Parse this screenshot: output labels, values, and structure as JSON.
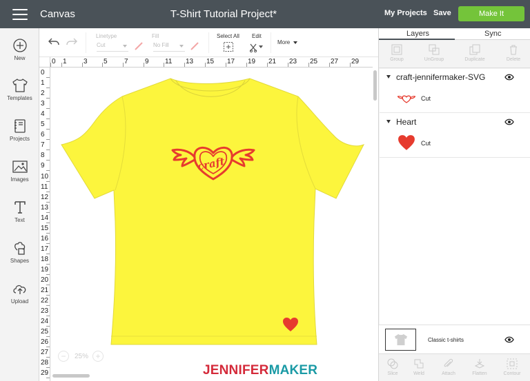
{
  "header": {
    "app_title": "Canvas",
    "project_title": "T-Shirt Tutorial Project*",
    "my_projects": "My Projects",
    "save": "Save",
    "make_it": "Make It"
  },
  "sidebar": {
    "items": [
      {
        "label": "New",
        "icon": "plus-circle-icon"
      },
      {
        "label": "Templates",
        "icon": "shirt-icon"
      },
      {
        "label": "Projects",
        "icon": "notebook-icon"
      },
      {
        "label": "Images",
        "icon": "image-icon"
      },
      {
        "label": "Text",
        "icon": "text-icon"
      },
      {
        "label": "Shapes",
        "icon": "shapes-icon"
      },
      {
        "label": "Upload",
        "icon": "cloud-upload-icon"
      }
    ]
  },
  "toolbar": {
    "linetype_label": "Linetype",
    "linetype_value": "Cut",
    "fill_label": "Fill",
    "fill_value": "No Fill",
    "select_all": "Select All",
    "edit": "Edit",
    "more": "More"
  },
  "rulers": {
    "top": [
      "0",
      "1",
      "3",
      "5",
      "7",
      "9",
      "11",
      "13",
      "15",
      "17",
      "19",
      "21",
      "23",
      "25",
      "27",
      "29"
    ],
    "left": [
      "0",
      "1",
      "2",
      "3",
      "4",
      "5",
      "6",
      "7",
      "8",
      "9",
      "10",
      "11",
      "12",
      "13",
      "14",
      "15",
      "16",
      "17",
      "18",
      "19",
      "20",
      "21",
      "22",
      "23",
      "24",
      "25",
      "26",
      "27",
      "28",
      "29"
    ]
  },
  "canvas": {
    "design_text": "craft",
    "zoom": "25%",
    "watermark_part1": "JENNIFER",
    "watermark_part2": "MAKER",
    "shirt_color": "#fcf53d",
    "design_color": "#e63b2e"
  },
  "panel": {
    "tabs": [
      "Layers",
      "Sync"
    ],
    "actions": [
      "Group",
      "UnGroup",
      "Duplicate",
      "Delete"
    ],
    "layers": [
      {
        "name": "craft-jennifermaker-SVG",
        "sub": "Cut"
      },
      {
        "name": "Heart",
        "sub": "Cut"
      }
    ],
    "canvas_layer": "Classic t-shirts",
    "bottom_actions": [
      "Slice",
      "Weld",
      "Attach",
      "Flatten",
      "Contour"
    ]
  }
}
